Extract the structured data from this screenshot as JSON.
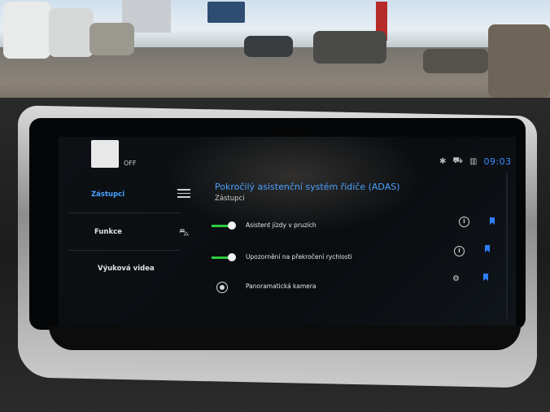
{
  "header": {
    "off_label": "OFF",
    "time": "09:03",
    "status_icons": [
      "bluetooth-icon",
      "car-connect-icon",
      "signal-icon"
    ]
  },
  "sidebar": {
    "items": [
      {
        "label": "Zástupci",
        "active": true
      },
      {
        "label": "Funkce",
        "active": false
      },
      {
        "label": "Výuková videa",
        "active": false
      }
    ]
  },
  "main": {
    "title": "Pokročilý asistenční systém řidiče (ADAS)",
    "subtitle": "Zástupci",
    "rows": [
      {
        "label": "Asistent jízdy v pruzích",
        "control": "toggle",
        "on": true
      },
      {
        "label": "Upozornění na překročení rychlosti",
        "control": "toggle",
        "on": true
      },
      {
        "label": "Panoramatická kamera",
        "control": "camera-icon",
        "on": null
      }
    ]
  },
  "colors": {
    "accent": "#4aa0ff",
    "toggle_on": "#2ecc40",
    "bookmark": "#2d7fff"
  }
}
